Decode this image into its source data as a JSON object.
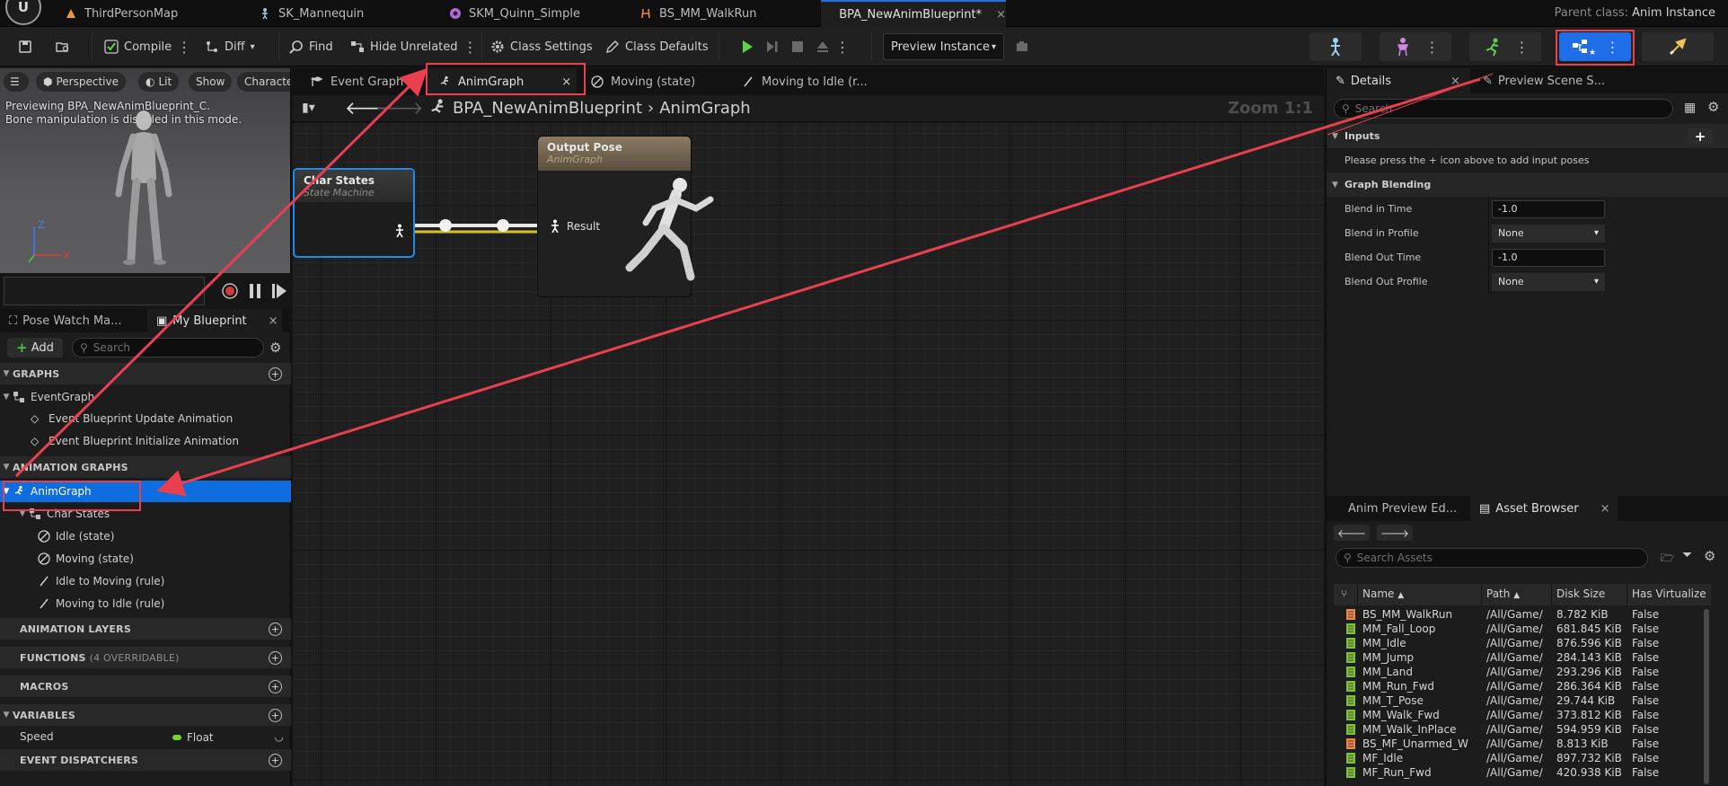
{
  "doc_tabs": [
    {
      "label": "ThirdPersonMap"
    },
    {
      "label": "SK_Mannequin"
    },
    {
      "label": "SKM_Quinn_Simple"
    },
    {
      "label": "BS_MM_WalkRun"
    },
    {
      "label": "BPA_NewAnimBlueprint*"
    }
  ],
  "doc_close": "×",
  "parent_class": {
    "label": "Parent class:",
    "value": "Anim Instance"
  },
  "toolbar": {
    "compile": "Compile",
    "diff": "Diff",
    "find": "Find",
    "hide_unrelated": "Hide Unrelated",
    "class_settings": "Class Settings",
    "class_defaults": "Class Defaults",
    "preview_instance": "Preview Instance",
    "dots": "⋮"
  },
  "viewport": {
    "perspective": "Perspective",
    "lit": "Lit",
    "show": "Show",
    "character": "Characte",
    "note_line1": "Previewing BPA_NewAnimBlueprint_C.",
    "note_line2": "Bone manipulation is disabled in this mode.",
    "axis_z": "Z",
    "axis_x": "X"
  },
  "left_tabs": {
    "pose_watch": "Pose Watch Ma...",
    "my_blueprint": "My Blueprint",
    "close": "×"
  },
  "my_blueprint": {
    "add": "Add",
    "search_placeholder": "Search",
    "graphs": "GRAPHS",
    "event_graph": "EventGraph",
    "event_update": "Event Blueprint Update Animation",
    "event_init": "Event Blueprint Initialize Animation",
    "animation_graphs": "ANIMATION GRAPHS",
    "anim_graph": "AnimGraph",
    "char_states": "Char States",
    "idle_state": "Idle (state)",
    "moving_state": "Moving (state)",
    "idle_to_moving": "Idle to Moving (rule)",
    "moving_to_idle": "Moving to Idle (rule)",
    "animation_layers": "ANIMATION LAYERS",
    "functions": "FUNCTIONS",
    "functions_sub": "(4 OVERRIDABLE)",
    "macros": "MACROS",
    "variables": "VARIABLES",
    "speed": "Speed",
    "float": "Float",
    "event_dispatchers": "EVENT DISPATCHERS",
    "plus": "+"
  },
  "graph_tabs": {
    "event_graph": "Event Graph",
    "anim_graph": "AnimGraph",
    "moving_state": "Moving (state)",
    "moving_to_idle": "Moving to Idle (r...",
    "close": "×"
  },
  "breadcrumb": {
    "blueprint": "BPA_NewAnimBlueprint",
    "sep": "›",
    "graph": "AnimGraph"
  },
  "zoom": "Zoom 1:1",
  "nodes": {
    "char_states": {
      "title": "Char States",
      "subtitle": "State Machine"
    },
    "output_pose": {
      "title": "Output Pose",
      "subtitle": "AnimGraph",
      "pin": "Result"
    }
  },
  "details_tabs": {
    "details": "Details",
    "preview_scene": "Preview Scene S...",
    "close": "×"
  },
  "details": {
    "search_placeholder": "Search",
    "inputs": "Inputs",
    "inputs_hint": "Please press the + icon above to add input poses",
    "graph_blending": "Graph Blending",
    "blend_in_time": {
      "label": "Blend in Time",
      "value": "-1.0"
    },
    "blend_in_profile": {
      "label": "Blend in Profile",
      "value": "None"
    },
    "blend_out_time": {
      "label": "Blend Out Time",
      "value": "-1.0"
    },
    "blend_out_profile": {
      "label": "Blend Out Profile",
      "value": "None"
    },
    "plus": "+"
  },
  "asset_tabs": {
    "anim_preview": "Anim Preview Ed...",
    "asset_browser": "Asset Browser",
    "close": "×"
  },
  "asset_browser": {
    "search_placeholder": "Search Assets",
    "columns": {
      "name": "Name",
      "path": "Path",
      "disk_size": "Disk Size",
      "has_virtualized": "Has Virtualize"
    },
    "rows": [
      {
        "name": "BS_MM_WalkRun",
        "path": "/All/Game/",
        "size": "8.782 KiB",
        "virt": "False",
        "type": "blendspace"
      },
      {
        "name": "MM_Fall_Loop",
        "path": "/All/Game/",
        "size": "681.845 KiB",
        "virt": "False",
        "type": "anim"
      },
      {
        "name": "MM_Idle",
        "path": "/All/Game/",
        "size": "876.596 KiB",
        "virt": "False",
        "type": "anim"
      },
      {
        "name": "MM_Jump",
        "path": "/All/Game/",
        "size": "284.143 KiB",
        "virt": "False",
        "type": "anim"
      },
      {
        "name": "MM_Land",
        "path": "/All/Game/",
        "size": "293.296 KiB",
        "virt": "False",
        "type": "anim"
      },
      {
        "name": "MM_Run_Fwd",
        "path": "/All/Game/",
        "size": "286.364 KiB",
        "virt": "False",
        "type": "anim"
      },
      {
        "name": "MM_T_Pose",
        "path": "/All/Game/",
        "size": "29.744 KiB",
        "virt": "False",
        "type": "anim"
      },
      {
        "name": "MM_Walk_Fwd",
        "path": "/All/Game/",
        "size": "373.812 KiB",
        "virt": "False",
        "type": "anim"
      },
      {
        "name": "MM_Walk_InPlace",
        "path": "/All/Game/",
        "size": "594.959 KiB",
        "virt": "False",
        "type": "anim"
      },
      {
        "name": "BS_MF_Unarmed_W",
        "path": "/All/Game/",
        "size": "8.813 KiB",
        "virt": "False",
        "type": "blendspace"
      },
      {
        "name": "MF_Idle",
        "path": "/All/Game/",
        "size": "897.732 KiB",
        "virt": "False",
        "type": "anim"
      },
      {
        "name": "MF_Run_Fwd",
        "path": "/All/Game/",
        "size": "420.938 KiB",
        "virt": "False",
        "type": "anim"
      }
    ]
  },
  "colors": {
    "accent": "#0e6ee0",
    "highlight": "#e8404f",
    "anim_asset": "#7fbf3a",
    "blendspace_asset": "#e9864a",
    "float_pin": "#74d23b"
  }
}
